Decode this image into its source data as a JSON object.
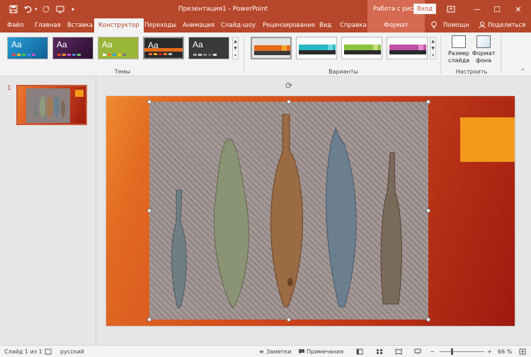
{
  "titlebar": {
    "save_icon": "save-icon",
    "undo_icon": "undo-icon",
    "redo_icon": "redo-icon",
    "start_icon": "from-beginning-icon",
    "customize_icon": "customize-qat-icon",
    "title": "Презентация1  -  PowerPoint",
    "context_title": "Работа с рис...",
    "login": "Вход",
    "ribbon_options_icon": "ribbon-options-icon",
    "minimize": "—",
    "maximize": "☐",
    "close": "✕"
  },
  "tabs": {
    "file": "Файл",
    "home": "Главная",
    "insert": "Вставка",
    "design": "Конструктор",
    "transitions": "Переходы",
    "animation": "Анимация",
    "slideshow": "Слайд-шоу",
    "review": "Рецензирование",
    "view": "Вид",
    "help": "Справка",
    "format": "Формат",
    "tellme": "Помощн",
    "share": "Поделиться"
  },
  "ribbon": {
    "themes_label": "Темы",
    "variants_label": "Варианты",
    "customize_label": "Настроить",
    "slide_size": "Размер слайда",
    "slide_size_l1": "Размер",
    "slide_size_l2": "слайда",
    "bg_format": "Формат фона",
    "bg_format_l1": "Формат",
    "bg_format_l2": "фона",
    "theme_aa": "Aa"
  },
  "colors": {
    "brand": "#b7472a",
    "context": "#d56a50",
    "slide_orange": "#f08a2e",
    "slide_red": "#9e1a0e",
    "accent": "#f29a1c"
  },
  "thumbnails": {
    "slide_number": "1"
  },
  "status": {
    "slide_info": "Слайд 1 из 1",
    "language": "русский",
    "notes": "Заметки",
    "comments": "Примечания",
    "zoom_minus": "−",
    "zoom_plus": "+",
    "zoom": "66 %"
  }
}
